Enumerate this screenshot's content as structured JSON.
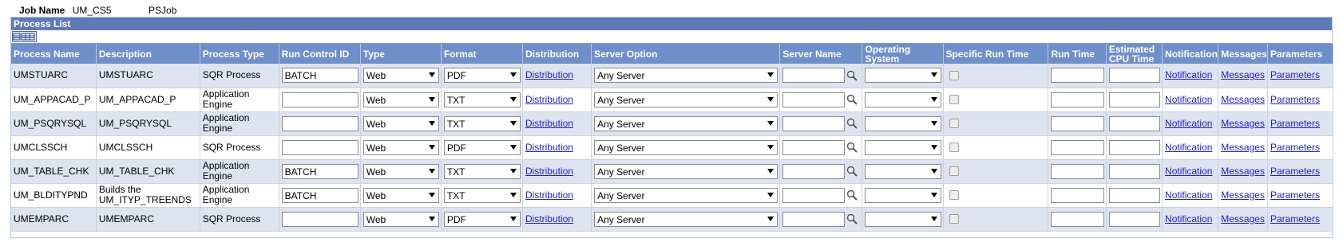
{
  "job": {
    "label": "Job Name",
    "name": "UM_CS5",
    "type": "PSJob"
  },
  "panel": {
    "title": "Process List"
  },
  "columns": [
    "Process Name",
    "Description",
    "Process Type",
    "Run Control ID",
    "Type",
    "Format",
    "Distribution",
    "Server Option",
    "Server Name",
    "Operating System",
    "Specific Run Time",
    "Run Time",
    "Estimated CPU Time",
    "Notification",
    "Messages",
    "Parameters"
  ],
  "links": {
    "distribution": "Distribution",
    "notification": "Notification",
    "messages": "Messages",
    "parameters": "Parameters"
  },
  "rows": [
    {
      "process_name": "UMSTUARC",
      "description": "UMSTUARC",
      "process_type": "SQR Process",
      "run_control_id": "BATCH",
      "type": "Web",
      "format": "PDF",
      "server_option": "Any Server",
      "server_name": "",
      "operating_system": "",
      "specific_run_time": false,
      "run_time": "",
      "estimated_cpu_time": ""
    },
    {
      "process_name": "UM_APPACAD_P",
      "description": "UM_APPACAD_P",
      "process_type": "Application Engine",
      "run_control_id": "",
      "type": "Web",
      "format": "TXT",
      "server_option": "Any Server",
      "server_name": "",
      "operating_system": "",
      "specific_run_time": false,
      "run_time": "",
      "estimated_cpu_time": ""
    },
    {
      "process_name": "UM_PSQRYSQL",
      "description": "UM_PSQRYSQL",
      "process_type": "Application Engine",
      "run_control_id": "",
      "type": "Web",
      "format": "TXT",
      "server_option": "Any Server",
      "server_name": "",
      "operating_system": "",
      "specific_run_time": false,
      "run_time": "",
      "estimated_cpu_time": ""
    },
    {
      "process_name": "UMCLSSCH",
      "description": "UMCLSSCH",
      "process_type": "SQR Process",
      "run_control_id": "",
      "type": "Web",
      "format": "PDF",
      "server_option": "Any Server",
      "server_name": "",
      "operating_system": "",
      "specific_run_time": false,
      "run_time": "",
      "estimated_cpu_time": ""
    },
    {
      "process_name": "UM_TABLE_CHK",
      "description": "UM_TABLE_CHK",
      "process_type": "Application Engine",
      "run_control_id": "BATCH",
      "type": "Web",
      "format": "TXT",
      "server_option": "Any Server",
      "server_name": "",
      "operating_system": "",
      "specific_run_time": false,
      "run_time": "",
      "estimated_cpu_time": ""
    },
    {
      "process_name": "UM_BLDITYPND",
      "description": "Builds the UM_ITYP_TREENDS",
      "process_type": "Application Engine",
      "run_control_id": "BATCH",
      "type": "Web",
      "format": "TXT",
      "server_option": "Any Server",
      "server_name": "",
      "operating_system": "",
      "specific_run_time": false,
      "run_time": "",
      "estimated_cpu_time": ""
    },
    {
      "process_name": "UMEMPARC",
      "description": "UMEMPARC",
      "process_type": "SQR Process",
      "run_control_id": "",
      "type": "Web",
      "format": "PDF",
      "server_option": "Any Server",
      "server_name": "",
      "operating_system": "",
      "specific_run_time": false,
      "run_time": "",
      "estimated_cpu_time": ""
    }
  ]
}
